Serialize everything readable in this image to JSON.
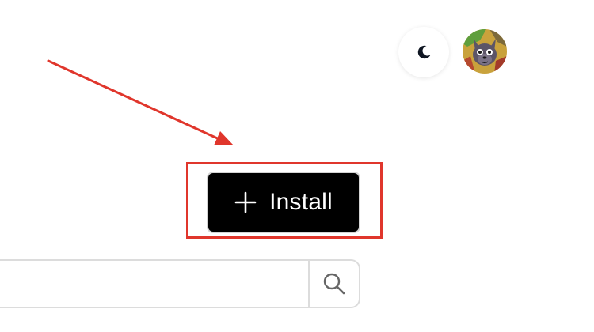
{
  "header": {
    "theme_toggle": {
      "icon": "moon-icon"
    },
    "avatar": {
      "icon": "avatar-image"
    }
  },
  "install_button": {
    "icon": "plus-icon",
    "label": "Install"
  },
  "search": {
    "value": "",
    "placeholder": "",
    "button_icon": "search-icon"
  },
  "annotation": {
    "color": "#e0362c"
  },
  "colors": {
    "button_background": "#000000",
    "button_text": "#ffffff",
    "border": "#dcdcdc"
  }
}
